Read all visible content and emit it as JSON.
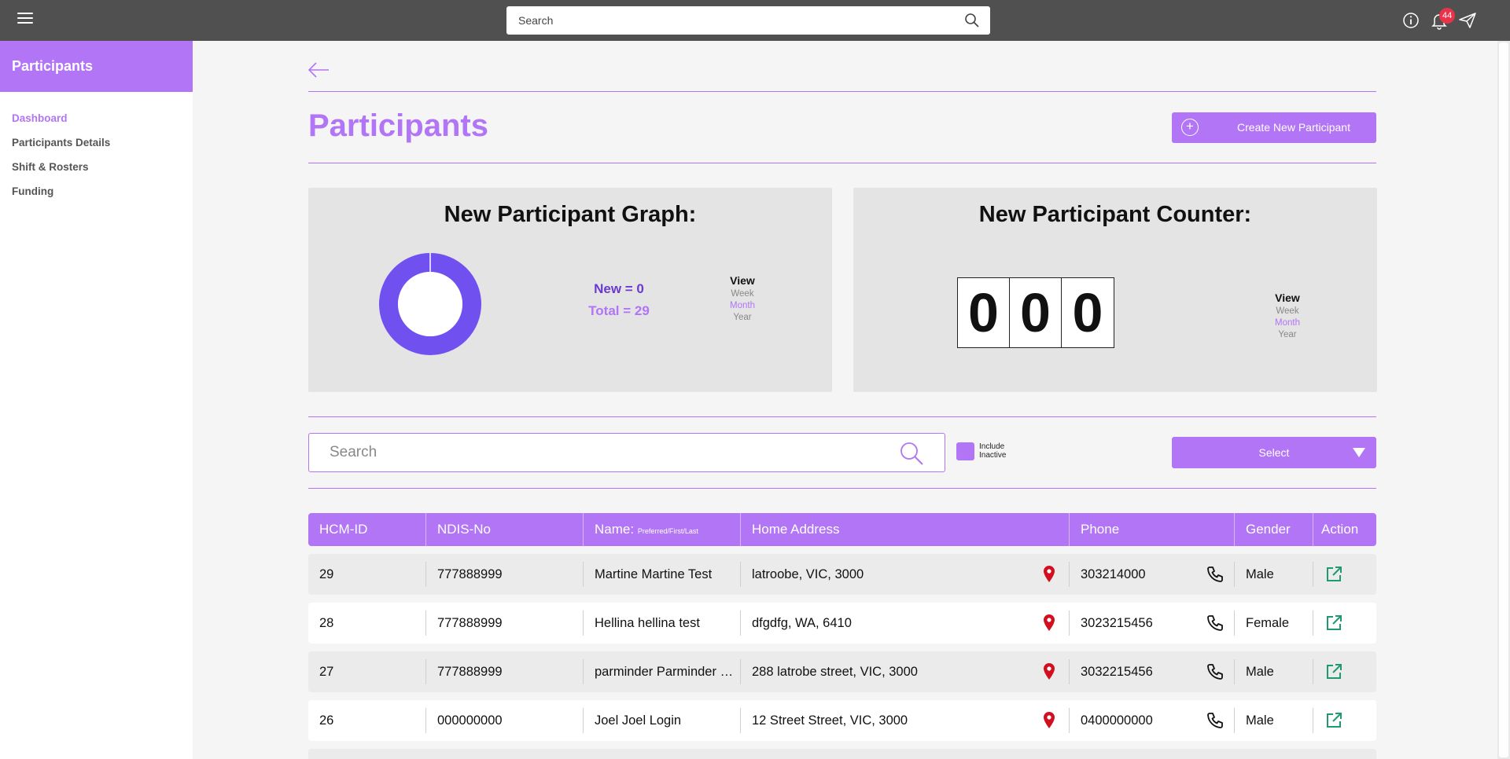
{
  "topbar": {
    "search_placeholder": "Search",
    "notification_count": "44"
  },
  "sidebar": {
    "title": "Participants",
    "items": [
      {
        "label": "Dashboard",
        "active": true
      },
      {
        "label": "Participants Details",
        "active": false
      },
      {
        "label": "Shift & Rosters",
        "active": false
      },
      {
        "label": "Funding",
        "active": false
      }
    ]
  },
  "page": {
    "title": "Participants",
    "create_button": "Create New Participant"
  },
  "graph_card": {
    "title": "New Participant Graph:",
    "new_label": "New = 0",
    "total_label": "Total = 29",
    "new": 0,
    "total": 29,
    "view": {
      "heading": "View",
      "options": [
        "Week",
        "Month",
        "Year"
      ],
      "selected": "Month"
    }
  },
  "counter_card": {
    "title": "New Participant Counter:",
    "digits": [
      "0",
      "0",
      "0"
    ],
    "view": {
      "heading": "View",
      "options": [
        "Week",
        "Month",
        "Year"
      ],
      "selected": "Month"
    }
  },
  "filters": {
    "search_placeholder": "Search",
    "include_inactive_line1": "Include",
    "include_inactive_line2": "Inactive",
    "select_label": "Select"
  },
  "table": {
    "columns": {
      "hcm_id": "HCM-ID",
      "ndis_no": "NDIS-No",
      "name": "Name:",
      "name_sub": "Preferred/First/Last",
      "address": "Home Address",
      "phone": "Phone",
      "gender": "Gender",
      "action": "Action"
    },
    "rows": [
      {
        "hcm_id": "29",
        "ndis_no": "777888999",
        "name": "Martine Martine Test",
        "address": "latroobe, VIC, 3000",
        "phone": "303214000",
        "gender": "Male"
      },
      {
        "hcm_id": "28",
        "ndis_no": "777888999",
        "name": "Hellina hellina test",
        "address": "dfgdfg, WA, 6410",
        "phone": "3023215456",
        "gender": "Female"
      },
      {
        "hcm_id": "27",
        "ndis_no": "777888999",
        "name": "parminder Parminder Singh",
        "address": "288 latrobe street, VIC, 3000",
        "phone": "3032215456",
        "gender": "Male"
      },
      {
        "hcm_id": "26",
        "ndis_no": "000000000",
        "name": "Joel Joel Login",
        "address": "12 Street Street, VIC, 3000",
        "phone": "0400000000",
        "gender": "Male"
      }
    ]
  },
  "colors": {
    "accent": "#b175f5",
    "donut": "#7150f0",
    "pin": "#d10f1f",
    "action": "#1f9a6e",
    "topbar": "#505050"
  }
}
